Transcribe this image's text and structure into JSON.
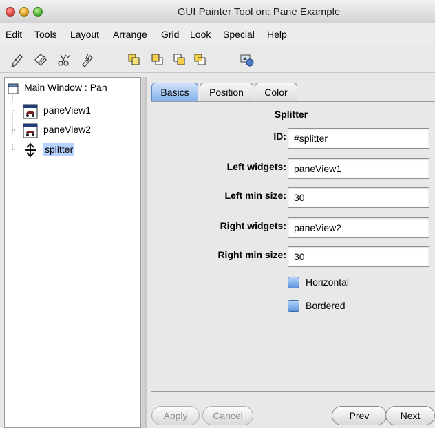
{
  "window": {
    "title": "GUI Painter Tool on: Pane Example"
  },
  "menu": [
    "Edit",
    "Tools",
    "Layout",
    "Arrange",
    "Grid",
    "Look",
    "Special",
    "Help"
  ],
  "toolbar": {
    "icons": [
      "pencil-check-icon",
      "pencil-diamond-icon",
      "scissors-pencil-icon",
      "pencil-lightning-icon",
      "bring-front-icon",
      "send-back-icon",
      "bring-forward-icon",
      "send-backward-icon",
      "widget-palette-icon"
    ]
  },
  "tree": {
    "root": "Main Window : Pan",
    "items": [
      {
        "label": "paneView1",
        "icon": "view-icon"
      },
      {
        "label": "paneView2",
        "icon": "view-icon"
      },
      {
        "label": "splitter",
        "icon": "splitter-icon",
        "selected": true
      }
    ]
  },
  "tabs": [
    {
      "label": "Basics",
      "active": true
    },
    {
      "label": "Position",
      "active": false
    },
    {
      "label": "Color",
      "active": false
    }
  ],
  "form": {
    "title": "Splitter",
    "fields": [
      {
        "label": "ID:",
        "value": "#splitter"
      },
      {
        "label": "Left widgets:",
        "value": "paneView1"
      },
      {
        "label": "Left min size:",
        "value": "30"
      },
      {
        "label": "Right widgets:",
        "value": "paneView2"
      },
      {
        "label": "Right min size:",
        "value": "30"
      }
    ],
    "checkboxes": [
      {
        "label": "Horizontal"
      },
      {
        "label": "Bordered"
      }
    ]
  },
  "buttons": {
    "apply": "Apply",
    "cancel": "Cancel",
    "prev": "Prev",
    "next": "Next"
  },
  "colors": {
    "accent": "#7fb0ea",
    "selection": "#b5d1ff"
  }
}
